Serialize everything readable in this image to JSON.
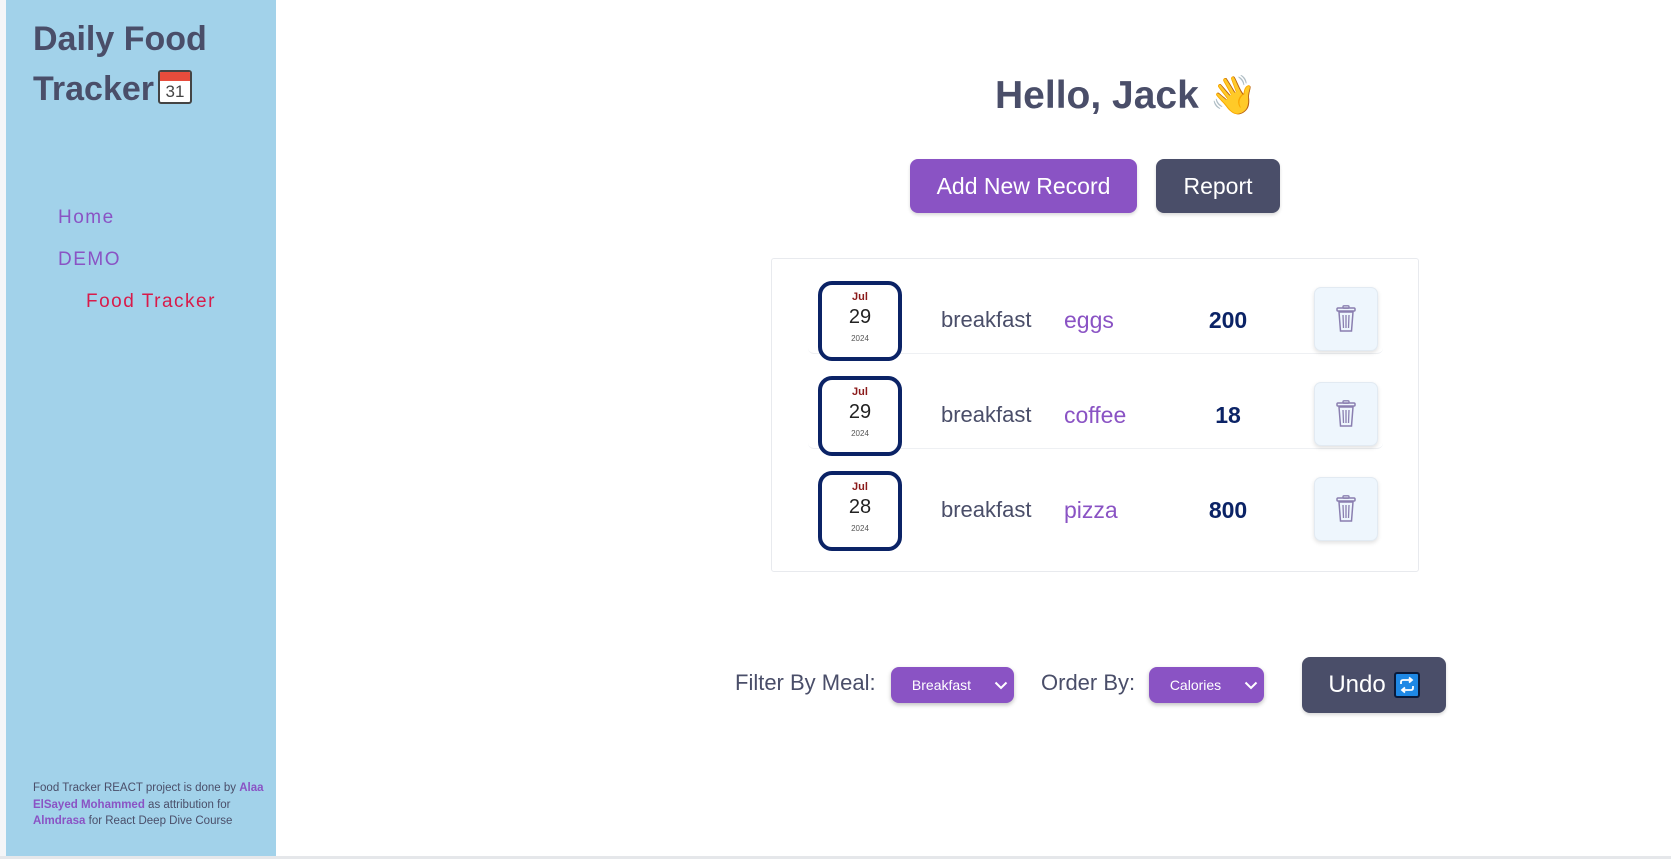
{
  "sidebar": {
    "title_line1": "Daily Food",
    "title_line2": "Tracker",
    "title_icon": "calendar-icon",
    "title_icon_day": "31",
    "nav": [
      {
        "label": "Home"
      },
      {
        "label": "DEMO"
      },
      {
        "label": "Food Tracker",
        "active": true
      }
    ],
    "footer": {
      "text1": "Food Tracker REACT project is done by",
      "author": "Alaa ElSayed Mohammed",
      "text2": "as attribution for",
      "org": "Almdrasa",
      "text3": "for React Deep Dive Course"
    }
  },
  "main": {
    "greeting": "Hello, Jack",
    "greeting_emoji": "👋",
    "add_button": "Add New Record",
    "report_button": "Report",
    "records": [
      {
        "month": "Jul",
        "day": "29",
        "year": "2024",
        "meal": "breakfast",
        "food": "eggs",
        "calories": "200"
      },
      {
        "month": "Jul",
        "day": "29",
        "year": "2024",
        "meal": "breakfast",
        "food": "coffee",
        "calories": "18"
      },
      {
        "month": "Jul",
        "day": "28",
        "year": "2024",
        "meal": "breakfast",
        "food": "pizza",
        "calories": "800"
      }
    ],
    "filter_label": "Filter By Meal:",
    "filter_value": "Breakfast",
    "order_label": "Order By:",
    "order_value": "Calories",
    "undo_button": "Undo"
  },
  "colors": {
    "sidebar_bg": "#a2d2ea",
    "accent_purple": "#8a53c4",
    "dark_slate": "#4a4e69",
    "navy": "#0b2366",
    "active_link": "#d81b4a"
  }
}
